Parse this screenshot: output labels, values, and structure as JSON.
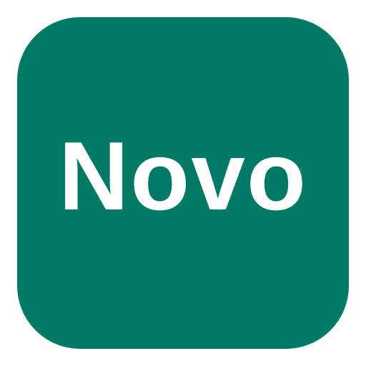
{
  "icon": {
    "label": "Novo",
    "background_color": "#017964",
    "text_color": "#ffffff"
  }
}
